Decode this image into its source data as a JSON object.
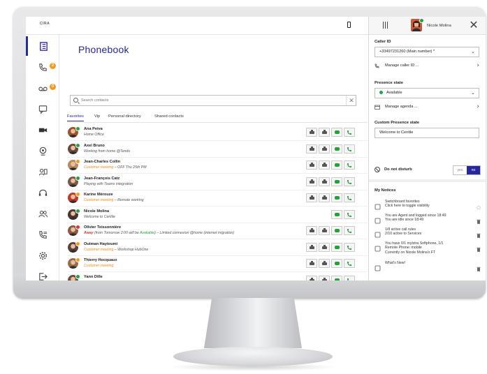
{
  "topbar": {
    "logo": "CIRA"
  },
  "nav": {
    "badges": {
      "calls": "2",
      "voicemail": "0"
    }
  },
  "phonebook": {
    "title": "Phonebook",
    "search_placeholder": "Search contacts",
    "clear": "✕",
    "tabs": [
      "Favorites",
      "Vip",
      "Personal directory",
      "Shared contacts"
    ],
    "contacts": [
      {
        "name": "Ana Peiva",
        "status": "green",
        "sub": [
          {
            "t": "Home Office",
            "c": "dim"
          }
        ]
      },
      {
        "name": "Axel Bruno",
        "status": "green",
        "sub": [
          {
            "t": "Working from home @Tendo",
            "c": "dim"
          }
        ]
      },
      {
        "name": "Jean-Charles Collin",
        "status": "orange",
        "sub": [
          {
            "t": "Customer meeting",
            "c": "hl"
          },
          {
            "t": " – OFF Thu 25th PM",
            "c": "dim"
          }
        ]
      },
      {
        "name": "Jean-François Catz",
        "status": "green",
        "sub": [
          {
            "t": "Playing with Teams integration",
            "c": "dim"
          }
        ]
      },
      {
        "name": "Karine Mérouze",
        "status": "orange",
        "sub": [
          {
            "t": "Customer meeting",
            "c": "hl"
          },
          {
            "t": " – Remote working",
            "c": "dim"
          }
        ]
      },
      {
        "name": "Nicole Molina",
        "status": "green",
        "sub": [
          {
            "t": "Welcome to Centile",
            "c": "dim"
          }
        ]
      },
      {
        "name": "Olivier Teissonnière",
        "status": "red",
        "sub": [
          {
            "t": "Away",
            "c": "away"
          },
          {
            "t": " (from Tomorrow 2:00 will be ",
            "c": "dim"
          },
          {
            "t": "Available",
            "c": "avail"
          },
          {
            "t": ") – Limited connexion @home (internet migration)",
            "c": "dim"
          }
        ]
      },
      {
        "name": "Outman Haytoumi",
        "status": "orange",
        "sub": [
          {
            "t": "Customer meeting",
            "c": "hl"
          },
          {
            "t": " – Workshop HubOne",
            "c": "dim"
          }
        ]
      },
      {
        "name": "Thierry Hocquaux",
        "status": "orange",
        "sub": [
          {
            "t": "Customer meeting",
            "c": "hl"
          }
        ]
      },
      {
        "name": "Yann Dille",
        "status": "green",
        "sub": []
      }
    ]
  },
  "user": {
    "name": "Nicole Molina"
  },
  "right": {
    "caller_id_label": "Caller ID",
    "caller_id_value": "+33497231260 (Main number) *",
    "manage_caller_id": "Manage caller ID ...",
    "presence_label": "Presence state",
    "presence_value": "Available",
    "manage_agenda": "Manage agenda ...",
    "custom_presence_label": "Custom Presence state",
    "custom_presence_value": "Welcome to Centile",
    "dnd_label": "Do not disturb",
    "dnd_yes": "yes",
    "dnd_no": "no",
    "notices_label": "My Notices",
    "notices": [
      {
        "icon": "switchboard-icon",
        "text": "Switchboard favorites\nClick here to toggle visibility"
      },
      {
        "icon": "headset-icon",
        "text": "You are Agent and logged since 18:49\nYou are idle since 18:49"
      },
      {
        "icon": "call-rules-icon",
        "text": "1/8 active call rules\n2/10 active to Services"
      },
      {
        "icon": "mobile-icon",
        "text": "You have 0/1 mylstra Softphone, 1/1\nRemote Phone: mobile\nCurrently on Nicole Molina's FT"
      },
      {
        "icon": "tools-icon",
        "text": "What's New!"
      }
    ]
  },
  "colors": {
    "brand": "#26279a",
    "available": "#1fa33a",
    "busy": "#f29b1e",
    "away": "#d9382e"
  }
}
